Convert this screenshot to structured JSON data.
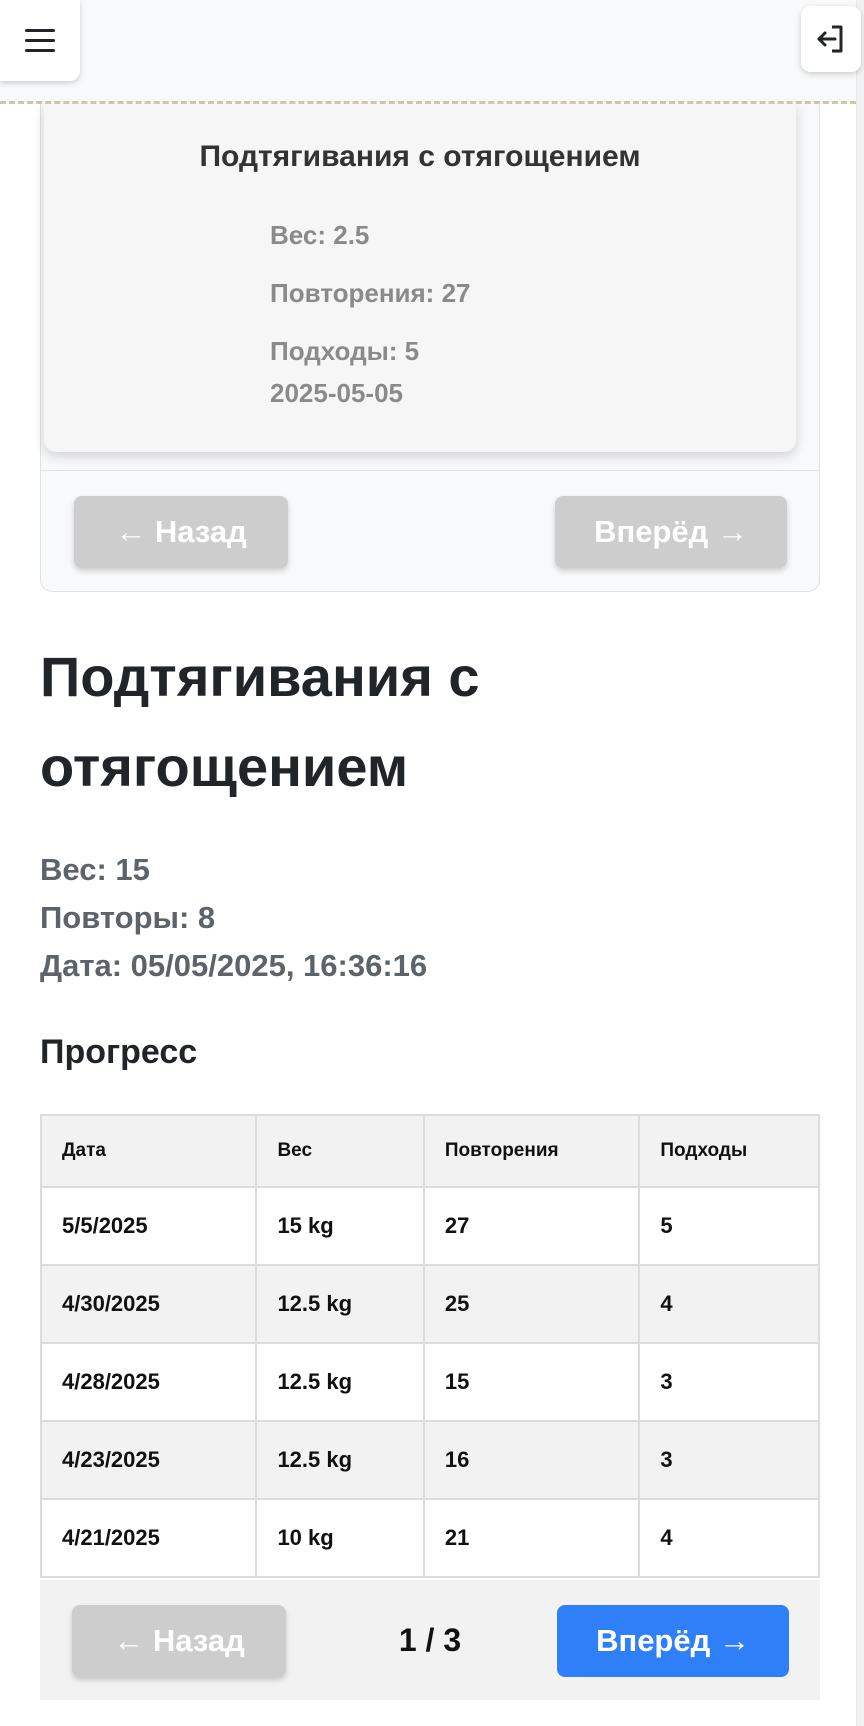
{
  "header": {
    "menu_icon": "hamburger-menu-icon",
    "logout_icon": "logout-icon"
  },
  "previous_record": {
    "title": "Подтягивания с отягощением",
    "weight": "Вес: 2.5",
    "reps": "Повторения: 27",
    "sets": "Подходы: 5",
    "date": "2025-05-05",
    "back_label": "← Назад",
    "forward_label": "Вперёд →"
  },
  "exercise": {
    "title": "Подтягивания с отягощением",
    "weight": "Вес: 15",
    "reps": "Повторы: 8",
    "date": "Дата: 05/05/2025, 16:36:16"
  },
  "progress": {
    "heading": "Прогресс",
    "columns": [
      "Дата",
      "Вес",
      "Повторения",
      "Подходы"
    ],
    "rows": [
      [
        "5/5/2025",
        "15 kg",
        "27",
        "5"
      ],
      [
        "4/30/2025",
        "12.5 kg",
        "25",
        "4"
      ],
      [
        "4/28/2025",
        "12.5 kg",
        "15",
        "3"
      ],
      [
        "4/23/2025",
        "12.5 kg",
        "16",
        "3"
      ],
      [
        "4/21/2025",
        "10 kg",
        "21",
        "4"
      ]
    ]
  },
  "pagination": {
    "back_label": "← Назад",
    "page_indicator": "1 / 3",
    "forward_label": "Вперёд →"
  },
  "colors": {
    "primary": "#2f80f8",
    "disabled": "#cdcdcd"
  }
}
